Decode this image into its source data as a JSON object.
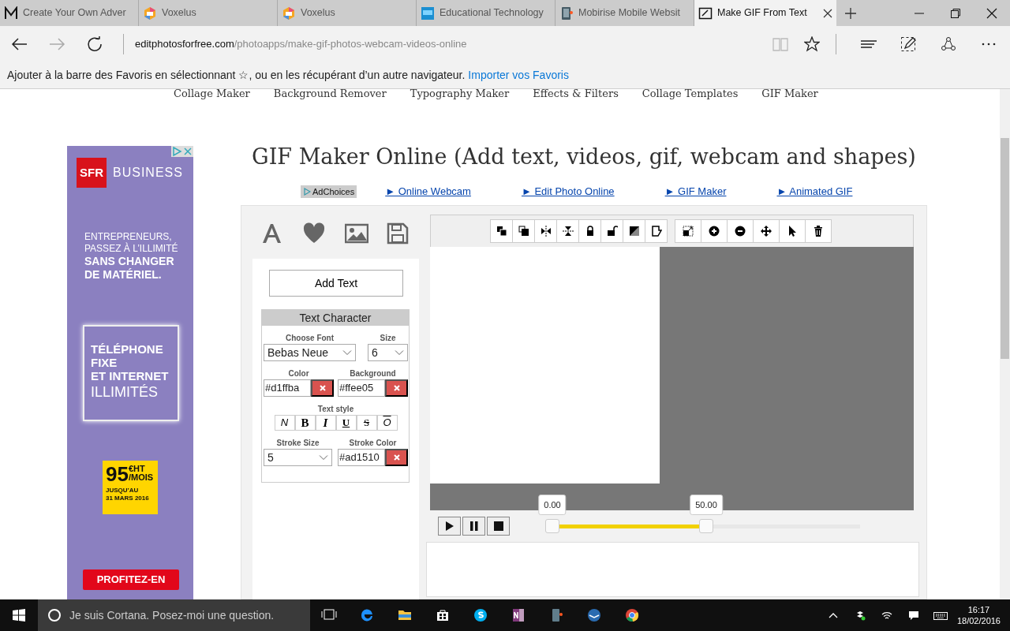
{
  "browser": {
    "tabs": [
      {
        "title": "Create Your Own Adver",
        "selected": false
      },
      {
        "title": "Voxelus",
        "selected": false
      },
      {
        "title": "Voxelus",
        "selected": false
      },
      {
        "title": "Educational Technology",
        "selected": false
      },
      {
        "title": "Mobirise Mobile Websit",
        "selected": false
      },
      {
        "title": "Make GIF From Text",
        "selected": true
      }
    ],
    "address": {
      "domain": "editphotosforfree.com",
      "path": "/photoapps/make-gif-photos-webcam-videos-online"
    },
    "favorites_bar": {
      "message": "Ajouter à la barre des Favoris en sélectionnant ☆, ou en les récupérant d’un autre navigateur.",
      "link": "Importer vos Favoris"
    }
  },
  "page": {
    "nav": [
      "Collage Maker",
      "Background Remover",
      "Typography Maker",
      "Effects & Filters",
      "Collage Templates",
      "GIF Maker"
    ],
    "ad": {
      "brand": "SFR",
      "brand_suffix": "BUSINESS",
      "headline": [
        "ENTREPRENEURS,",
        "PASSEZ À L’ILLIMITÉ",
        "SANS CHANGER",
        "DE MATÉRIEL."
      ],
      "offer": [
        "TÉLÉPHONE",
        "FIXE",
        "ET INTERNET",
        "ILLIMITÉS"
      ],
      "price": "95",
      "price_unit": "€HT",
      "price_period": "/MOIS",
      "until": [
        "JUSQU’AU",
        "31 MARS 2016"
      ],
      "cta": "PROFITEZ-EN"
    },
    "title": "GIF Maker Online (Add text, videos, gif, webcam and shapes)",
    "adchoices": "AdChoices",
    "links": [
      "► Online Webcam",
      "► Edit Photo Online",
      "► GIF Maker",
      "► Animated GIF"
    ],
    "editor": {
      "add_button": "Add Text",
      "panel_title": "Text Character",
      "font": {
        "label": "Choose Font",
        "value": "Bebas Neue"
      },
      "size": {
        "label": "Size",
        "value": "6"
      },
      "color": {
        "label": "Color",
        "value": "#d1ffba"
      },
      "background": {
        "label": "Background",
        "value": "#ffee05"
      },
      "text_style": {
        "label": "Text style",
        "buttons": [
          {
            "text": "N",
            "kind": "normal"
          },
          {
            "text": "B",
            "kind": "bold"
          },
          {
            "text": "I",
            "kind": "italic"
          },
          {
            "text": "U",
            "kind": "underline"
          },
          {
            "text": "S",
            "kind": "strike"
          },
          {
            "text": "O",
            "kind": "overline"
          }
        ]
      },
      "stroke_size": {
        "label": "Stroke Size",
        "value": "5"
      },
      "stroke_color": {
        "label": "Stroke Color",
        "value": "#ad1510"
      },
      "timeline": {
        "handles": [
          {
            "label": "0.00",
            "level": 0
          },
          {
            "label": "50.00",
            "level": 0.5
          }
        ]
      }
    }
  },
  "taskbar": {
    "search_placeholder": "Je suis Cortana. Posez-moi une question.",
    "time": "16:17",
    "date": "18/02/2016"
  }
}
